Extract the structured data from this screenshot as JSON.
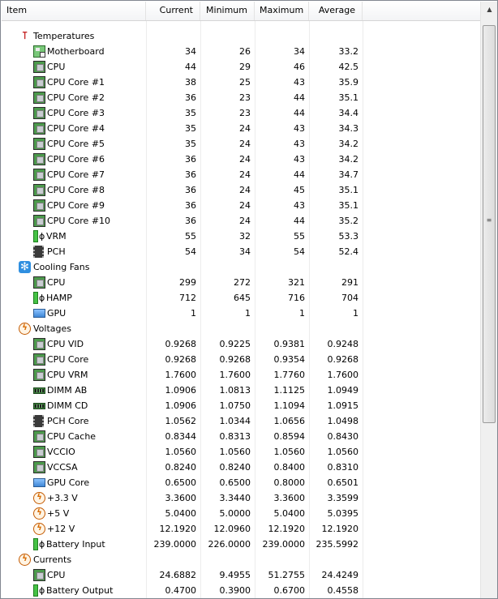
{
  "columns": {
    "item": "Item",
    "current": "Current",
    "minimum": "Minimum",
    "maximum": "Maximum",
    "average": "Average"
  },
  "groups": [
    {
      "icon": "thermometer-icon",
      "label": "Temperatures",
      "rows": [
        {
          "icon": "motherboard-icon",
          "label": "Motherboard",
          "values": [
            "34",
            "26",
            "34",
            "33.2"
          ]
        },
        {
          "icon": "cpu-chip-icon",
          "label": "CPU",
          "values": [
            "44",
            "29",
            "46",
            "42.5"
          ]
        },
        {
          "icon": "cpu-chip-icon",
          "label": "CPU Core #1",
          "values": [
            "38",
            "25",
            "43",
            "35.9"
          ]
        },
        {
          "icon": "cpu-chip-icon",
          "label": "CPU Core #2",
          "values": [
            "36",
            "23",
            "44",
            "35.1"
          ]
        },
        {
          "icon": "cpu-chip-icon",
          "label": "CPU Core #3",
          "values": [
            "35",
            "23",
            "44",
            "34.4"
          ]
        },
        {
          "icon": "cpu-chip-icon",
          "label": "CPU Core #4",
          "values": [
            "35",
            "24",
            "43",
            "34.3"
          ]
        },
        {
          "icon": "cpu-chip-icon",
          "label": "CPU Core #5",
          "values": [
            "35",
            "24",
            "43",
            "34.2"
          ]
        },
        {
          "icon": "cpu-chip-icon",
          "label": "CPU Core #6",
          "values": [
            "36",
            "24",
            "43",
            "34.2"
          ]
        },
        {
          "icon": "cpu-chip-icon",
          "label": "CPU Core #7",
          "values": [
            "36",
            "24",
            "44",
            "34.7"
          ]
        },
        {
          "icon": "cpu-chip-icon",
          "label": "CPU Core #8",
          "values": [
            "36",
            "24",
            "45",
            "35.1"
          ]
        },
        {
          "icon": "cpu-chip-icon",
          "label": "CPU Core #9",
          "values": [
            "36",
            "24",
            "43",
            "35.1"
          ]
        },
        {
          "icon": "cpu-chip-icon",
          "label": "CPU Core #10",
          "values": [
            "36",
            "24",
            "44",
            "35.2"
          ]
        },
        {
          "icon": "battery-plug-icon",
          "label": "VRM",
          "values": [
            "55",
            "32",
            "55",
            "53.3"
          ]
        },
        {
          "icon": "pch-chip-icon",
          "label": "PCH",
          "values": [
            "54",
            "34",
            "54",
            "52.4"
          ]
        }
      ]
    },
    {
      "icon": "fan-icon",
      "label": "Cooling Fans",
      "rows": [
        {
          "icon": "cpu-chip-icon",
          "label": "CPU",
          "values": [
            "299",
            "272",
            "321",
            "291"
          ]
        },
        {
          "icon": "battery-plug-icon",
          "label": "HAMP",
          "values": [
            "712",
            "645",
            "716",
            "704"
          ]
        },
        {
          "icon": "gpu-icon",
          "label": "GPU",
          "values": [
            "1",
            "1",
            "1",
            "1"
          ]
        }
      ]
    },
    {
      "icon": "voltage-icon",
      "label": "Voltages",
      "rows": [
        {
          "icon": "cpu-chip-icon",
          "label": "CPU VID",
          "values": [
            "0.9268",
            "0.9225",
            "0.9381",
            "0.9248"
          ]
        },
        {
          "icon": "cpu-chip-icon",
          "label": "CPU Core",
          "values": [
            "0.9268",
            "0.9268",
            "0.9354",
            "0.9268"
          ]
        },
        {
          "icon": "cpu-chip-icon",
          "label": "CPU VRM",
          "values": [
            "1.7600",
            "1.7600",
            "1.7760",
            "1.7600"
          ]
        },
        {
          "icon": "dimm-icon",
          "label": "DIMM AB",
          "values": [
            "1.0906",
            "1.0813",
            "1.1125",
            "1.0949"
          ]
        },
        {
          "icon": "dimm-icon",
          "label": "DIMM CD",
          "values": [
            "1.0906",
            "1.0750",
            "1.1094",
            "1.0915"
          ]
        },
        {
          "icon": "pch-chip-icon",
          "label": "PCH Core",
          "values": [
            "1.0562",
            "1.0344",
            "1.0656",
            "1.0498"
          ]
        },
        {
          "icon": "cpu-chip-icon",
          "label": "CPU Cache",
          "values": [
            "0.8344",
            "0.8313",
            "0.8594",
            "0.8430"
          ]
        },
        {
          "icon": "cpu-chip-icon",
          "label": "VCCIO",
          "values": [
            "1.0560",
            "1.0560",
            "1.0560",
            "1.0560"
          ]
        },
        {
          "icon": "cpu-chip-icon",
          "label": "VCCSA",
          "values": [
            "0.8240",
            "0.8240",
            "0.8400",
            "0.8310"
          ]
        },
        {
          "icon": "gpu-icon",
          "label": "GPU Core",
          "values": [
            "0.6500",
            "0.6500",
            "0.8000",
            "0.6501"
          ]
        },
        {
          "icon": "voltage-icon",
          "label": "+3.3 V",
          "values": [
            "3.3600",
            "3.3440",
            "3.3600",
            "3.3599"
          ]
        },
        {
          "icon": "voltage-icon",
          "label": "+5 V",
          "values": [
            "5.0400",
            "5.0000",
            "5.0400",
            "5.0395"
          ]
        },
        {
          "icon": "voltage-icon",
          "label": "+12 V",
          "values": [
            "12.1920",
            "12.0960",
            "12.1920",
            "12.1920"
          ]
        },
        {
          "icon": "battery-plug-icon",
          "label": "Battery Input",
          "values": [
            "239.0000",
            "226.0000",
            "239.0000",
            "235.5992"
          ]
        }
      ]
    },
    {
      "icon": "voltage-icon",
      "label": "Currents",
      "rows": [
        {
          "icon": "cpu-chip-icon",
          "label": "CPU",
          "values": [
            "24.6882",
            "9.4955",
            "51.2755",
            "24.4249"
          ]
        },
        {
          "icon": "battery-plug-icon",
          "label": "Battery Output",
          "values": [
            "0.4700",
            "0.3900",
            "0.6700",
            "0.4558"
          ]
        }
      ]
    }
  ]
}
